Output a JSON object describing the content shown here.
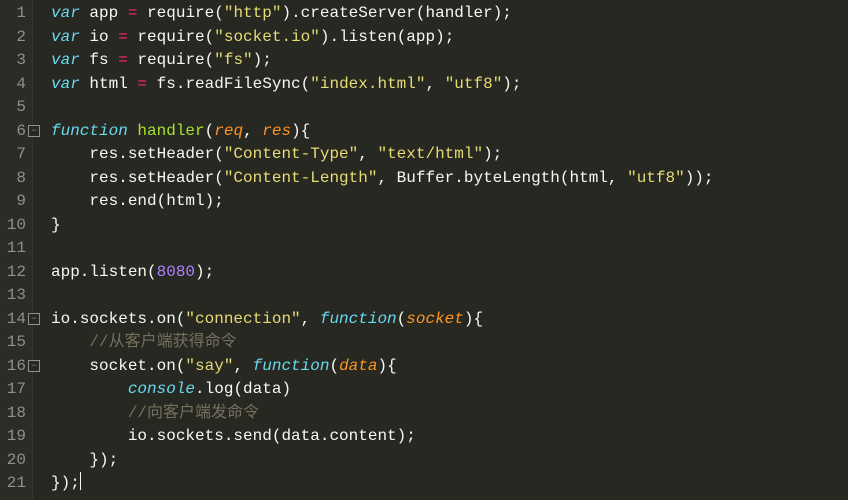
{
  "language": "javascript",
  "theme": "monokai",
  "gutter": {
    "lines": [
      {
        "num": "1"
      },
      {
        "num": "2"
      },
      {
        "num": "3"
      },
      {
        "num": "4"
      },
      {
        "num": "5"
      },
      {
        "num": "6",
        "fold": true
      },
      {
        "num": "7"
      },
      {
        "num": "8"
      },
      {
        "num": "9"
      },
      {
        "num": "10"
      },
      {
        "num": "11"
      },
      {
        "num": "12"
      },
      {
        "num": "13"
      },
      {
        "num": "14",
        "fold": true
      },
      {
        "num": "15"
      },
      {
        "num": "16",
        "fold": true
      },
      {
        "num": "17"
      },
      {
        "num": "18"
      },
      {
        "num": "19"
      },
      {
        "num": "20"
      },
      {
        "num": "21"
      }
    ],
    "fold_glyph": "−"
  },
  "code": {
    "lines": [
      {
        "tokens": [
          {
            "c": "kw",
            "t": "var"
          },
          {
            "c": "plain",
            "t": " app "
          },
          {
            "c": "op",
            "t": "="
          },
          {
            "c": "plain",
            "t": " require("
          },
          {
            "c": "str",
            "t": "\"http\""
          },
          {
            "c": "plain",
            "t": ").createServer(handler);"
          }
        ]
      },
      {
        "tokens": [
          {
            "c": "kw",
            "t": "var"
          },
          {
            "c": "plain",
            "t": " io "
          },
          {
            "c": "op",
            "t": "="
          },
          {
            "c": "plain",
            "t": " require("
          },
          {
            "c": "str",
            "t": "\"socket.io\""
          },
          {
            "c": "plain",
            "t": ").listen(app);"
          }
        ]
      },
      {
        "tokens": [
          {
            "c": "kw",
            "t": "var"
          },
          {
            "c": "plain",
            "t": " fs "
          },
          {
            "c": "op",
            "t": "="
          },
          {
            "c": "plain",
            "t": " require("
          },
          {
            "c": "str",
            "t": "\"fs\""
          },
          {
            "c": "plain",
            "t": ");"
          }
        ]
      },
      {
        "tokens": [
          {
            "c": "kw",
            "t": "var"
          },
          {
            "c": "plain",
            "t": " html "
          },
          {
            "c": "op",
            "t": "="
          },
          {
            "c": "plain",
            "t": " fs.readFileSync("
          },
          {
            "c": "str",
            "t": "\"index.html\""
          },
          {
            "c": "plain",
            "t": ", "
          },
          {
            "c": "str",
            "t": "\"utf8\""
          },
          {
            "c": "plain",
            "t": ");"
          }
        ]
      },
      {
        "tokens": []
      },
      {
        "tokens": [
          {
            "c": "storage",
            "t": "function"
          },
          {
            "c": "plain",
            "t": " "
          },
          {
            "c": "def",
            "t": "handler"
          },
          {
            "c": "plain",
            "t": "("
          },
          {
            "c": "param",
            "t": "req"
          },
          {
            "c": "plain",
            "t": ", "
          },
          {
            "c": "param",
            "t": "res"
          },
          {
            "c": "plain",
            "t": "){"
          }
        ]
      },
      {
        "tokens": [
          {
            "c": "plain",
            "t": "    res.setHeader("
          },
          {
            "c": "str",
            "t": "\"Content-Type\""
          },
          {
            "c": "plain",
            "t": ", "
          },
          {
            "c": "str",
            "t": "\"text/html\""
          },
          {
            "c": "plain",
            "t": ");"
          }
        ]
      },
      {
        "tokens": [
          {
            "c": "plain",
            "t": "    res.setHeader("
          },
          {
            "c": "str",
            "t": "\"Content-Length\""
          },
          {
            "c": "plain",
            "t": ", Buffer.byteLength(html, "
          },
          {
            "c": "str",
            "t": "\"utf8\""
          },
          {
            "c": "plain",
            "t": "));"
          }
        ]
      },
      {
        "tokens": [
          {
            "c": "plain",
            "t": "    res.end(html);"
          }
        ]
      },
      {
        "tokens": [
          {
            "c": "plain",
            "t": "}"
          }
        ]
      },
      {
        "tokens": []
      },
      {
        "tokens": [
          {
            "c": "plain",
            "t": "app.listen("
          },
          {
            "c": "num",
            "t": "8080"
          },
          {
            "c": "plain",
            "t": ");"
          }
        ]
      },
      {
        "tokens": []
      },
      {
        "tokens": [
          {
            "c": "plain",
            "t": "io.sockets.on("
          },
          {
            "c": "str",
            "t": "\"connection\""
          },
          {
            "c": "plain",
            "t": ", "
          },
          {
            "c": "storage",
            "t": "function"
          },
          {
            "c": "plain",
            "t": "("
          },
          {
            "c": "param",
            "t": "socket"
          },
          {
            "c": "plain",
            "t": "){"
          }
        ]
      },
      {
        "tokens": [
          {
            "c": "plain",
            "t": "    "
          },
          {
            "c": "comment",
            "t": "//从客户端获得命令"
          }
        ]
      },
      {
        "tokens": [
          {
            "c": "plain",
            "t": "    socket.on("
          },
          {
            "c": "str",
            "t": "\"say\""
          },
          {
            "c": "plain",
            "t": ", "
          },
          {
            "c": "storage",
            "t": "function"
          },
          {
            "c": "plain",
            "t": "("
          },
          {
            "c": "param",
            "t": "data"
          },
          {
            "c": "plain",
            "t": "){"
          }
        ]
      },
      {
        "tokens": [
          {
            "c": "plain",
            "t": "        "
          },
          {
            "c": "obj",
            "t": "console"
          },
          {
            "c": "plain",
            "t": ".log(data)"
          }
        ]
      },
      {
        "tokens": [
          {
            "c": "plain",
            "t": "        "
          },
          {
            "c": "comment",
            "t": "//向客户端发命令"
          }
        ]
      },
      {
        "tokens": [
          {
            "c": "plain",
            "t": "        io.sockets.send(data.content);"
          }
        ]
      },
      {
        "tokens": [
          {
            "c": "plain",
            "t": "    });"
          }
        ]
      },
      {
        "tokens": [
          {
            "c": "plain",
            "t": "});"
          },
          {
            "c": "cursor",
            "t": ""
          }
        ]
      }
    ]
  }
}
